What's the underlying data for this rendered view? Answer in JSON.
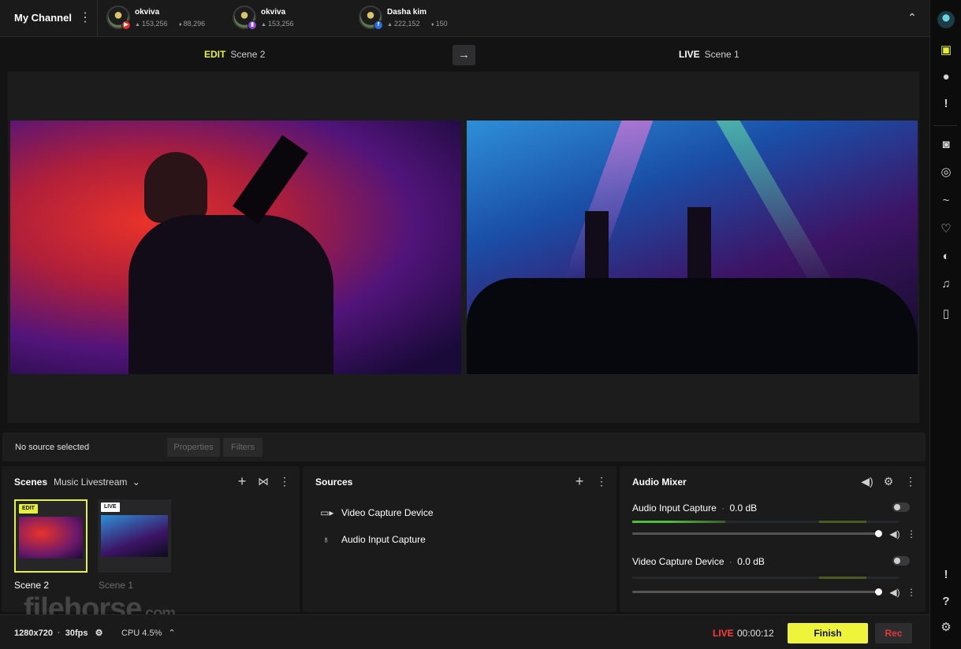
{
  "topbar": {
    "channel_title": "My Channel",
    "menu_glyph": "⋮",
    "collapse_glyph": "⌃",
    "accounts": [
      {
        "name": "okviva",
        "viewers": "153,256",
        "likes": "88,296",
        "platform": "youtube-icon",
        "badge_color": "#e62a2a"
      },
      {
        "name": "okviva",
        "viewers": "153,256",
        "likes": "",
        "platform": "twitch-icon",
        "badge_color": "#8e44d6"
      },
      {
        "name": "Dasha kim",
        "viewers": "222,152",
        "likes": "150",
        "platform": "facebook-icon",
        "badge_color": "#2d6cdf"
      }
    ],
    "viewer_glyph": "👤",
    "like_glyph": "👍"
  },
  "scene_labels": {
    "edit_kw": "EDIT",
    "edit_scene": "Scene 2",
    "live_kw": "LIVE",
    "live_scene": "Scene 1",
    "edit_color": "#e6f239",
    "transition_glyph": "→"
  },
  "properties_bar": {
    "status": "No source selected",
    "properties_label": "Properties",
    "filters_label": "Filters"
  },
  "scenes_panel": {
    "title": "Scenes",
    "collection": "Music Livestream",
    "dropdown_glyph": "⌄",
    "add_glyph": "+",
    "transition_glyph": "⋈",
    "menu_glyph": "⋮",
    "scenes": [
      {
        "name": "Scene 2",
        "badge": "EDIT",
        "selected": true
      },
      {
        "name": "Scene 1",
        "badge": "LIVE",
        "selected": false
      }
    ]
  },
  "sources_panel": {
    "title": "Sources",
    "add_glyph": "+",
    "menu_glyph": "⋮",
    "items": [
      {
        "label": "Video Capture Device",
        "icon": "camera-icon",
        "glyph": "▭"
      },
      {
        "label": "Audio Input Capture",
        "icon": "microphone-icon",
        "glyph": "🎙"
      }
    ]
  },
  "mixer_panel": {
    "title": "Audio Mixer",
    "volume_glyph": "🔊",
    "gear_glyph": "⚙",
    "menu_glyph": "⋮",
    "channels": [
      {
        "name": "Audio Input Capture",
        "level": "0.0 dB",
        "meter_level": 0.35,
        "volume": 1.0
      },
      {
        "name": "Video Capture Device",
        "level": "0.0 dB",
        "meter_level": 0.0,
        "volume": 1.0
      }
    ],
    "separator": "·"
  },
  "statusbar": {
    "resolution": "1280x720",
    "fps": "30fps",
    "separator": "·",
    "gear_glyph": "⚙",
    "cpu": "CPU 4.5%",
    "cpu_toggle_glyph": "⌃",
    "live_label": "LIVE",
    "live_time": "00:00:12",
    "finish_label": "Finish",
    "rec_label": "Rec"
  },
  "watermark": {
    "text": "filehorse",
    "suffix": ".com"
  },
  "right_rail": {
    "items": [
      {
        "name": "profile-avatar-icon",
        "glyph": "●"
      },
      {
        "name": "layout-icon",
        "glyph": "▣"
      },
      {
        "name": "chat-icon",
        "glyph": "💬"
      },
      {
        "name": "alert-icon",
        "glyph": "!"
      },
      {
        "name": "camera-icon",
        "glyph": "📷"
      },
      {
        "name": "webcam-icon",
        "glyph": "◎"
      },
      {
        "name": "signature-icon",
        "glyph": "✍"
      },
      {
        "name": "heart-badge-icon",
        "glyph": "♡"
      },
      {
        "name": "palette-icon",
        "glyph": "◐"
      },
      {
        "name": "music-icon",
        "glyph": "♫"
      },
      {
        "name": "remote-icon",
        "glyph": "▯"
      },
      {
        "name": "feedback-icon",
        "glyph": "!"
      },
      {
        "name": "help-icon",
        "glyph": "?"
      },
      {
        "name": "settings-icon",
        "glyph": "⚙"
      }
    ]
  }
}
